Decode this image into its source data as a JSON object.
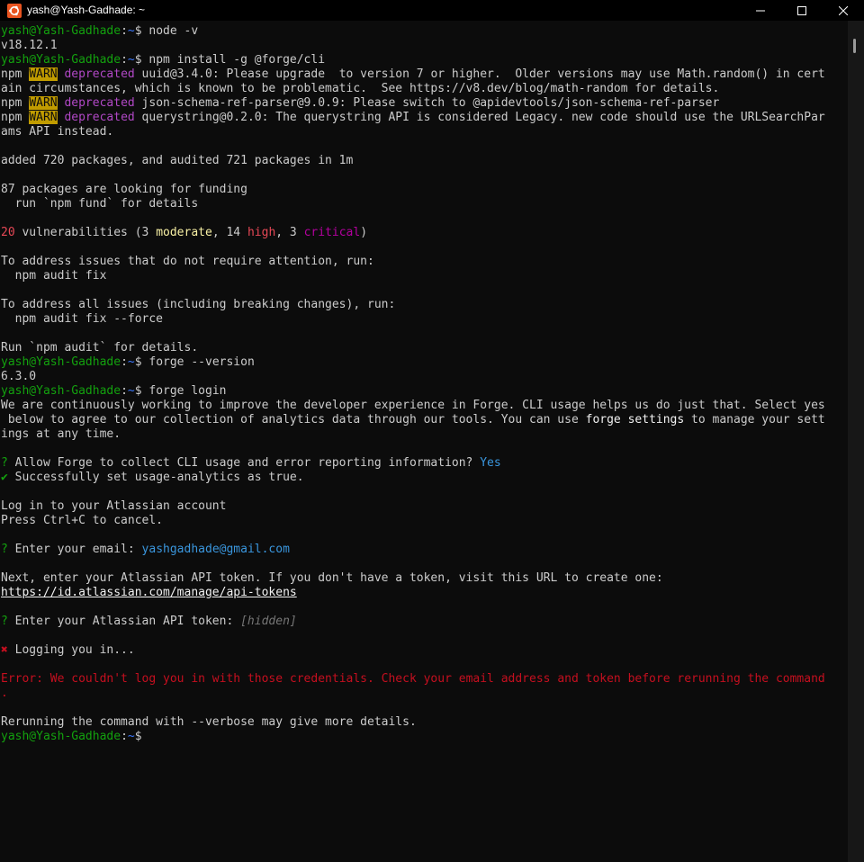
{
  "window": {
    "title": "yash@Yash-Gadhade: ~",
    "app_icon": "ubuntu-icon",
    "controls": [
      "minimize-icon",
      "maximize-icon",
      "close-icon"
    ]
  },
  "colors": {
    "prompt_user": "#13a10e",
    "prompt_path": "#3b78ff",
    "warn_badge": "#c19c00",
    "deprecated": "#b148c6",
    "error": "#c50f1f",
    "answer": "#3a96dd"
  },
  "prompts": [
    {
      "user": "yash@Yash-Gadhade",
      "sep": ":",
      "path": "~",
      "sym": "$ ",
      "cmd": "node -v"
    },
    {
      "user": "yash@Yash-Gadhade",
      "sep": ":",
      "path": "~",
      "sym": "$ ",
      "cmd": "npm install -g @forge/cli"
    },
    {
      "user": "yash@Yash-Gadhade",
      "sep": ":",
      "path": "~",
      "sym": "$ ",
      "cmd": "forge --version"
    },
    {
      "user": "yash@Yash-Gadhade",
      "sep": ":",
      "path": "~",
      "sym": "$ ",
      "cmd": "forge login"
    },
    {
      "user": "yash@Yash-Gadhade",
      "sep": ":",
      "path": "~",
      "sym": "$",
      "cmd": ""
    }
  ],
  "node_version": "v18.12.1",
  "warnings": [
    {
      "npm": "npm ",
      "badge": "WARN",
      "tag": " deprecated ",
      "msg": "uuid@3.4.0: Please upgrade  to version 7 or higher.  Older versions may use Math.random() in cert",
      "cont": "ain circumstances, which is known to be problematic.  See https://v8.dev/blog/math-random for details."
    },
    {
      "npm": "npm ",
      "badge": "WARN",
      "tag": " deprecated ",
      "msg": "json-schema-ref-parser@9.0.9: Please switch to @apidevtools/json-schema-ref-parser"
    },
    {
      "npm": "npm ",
      "badge": "WARN",
      "tag": " deprecated ",
      "msg": "querystring@0.2.0: The querystring API is considered Legacy. new code should use the URLSearchPar",
      "cont": "ams API instead."
    }
  ],
  "install": {
    "added": "added 720 packages, and audited 721 packages in 1m",
    "funding": "87 packages are looking for funding",
    "fund_hint": "  run `npm fund` for details"
  },
  "vulns": {
    "count": "20",
    "text_a": " vulnerabilities (3 ",
    "moderate": "moderate",
    "text_b": ", 14 ",
    "high": "high",
    "text_c": ", 3 ",
    "critical": "critical",
    "text_d": ")"
  },
  "audit": {
    "no_attention": "To address issues that do not require attention, run:",
    "fix_cmd": "  npm audit fix",
    "all_issues": "To address all issues (including breaking changes), run:",
    "force_cmd": "  npm audit fix --force",
    "details": "Run `npm audit` for details."
  },
  "forge_version": "6.3.0",
  "login": {
    "intro_1": "We are continuously working to improve the developer experience in Forge. CLI usage helps us do just that. Select yes",
    "intro_2a": " below to agree to our collection of analytics data through our tools. You can use ",
    "intro_2b": "forge settings",
    "intro_2c": " to manage your sett",
    "intro_3": "ings at any time.",
    "q_mark": "?",
    "q_analytics": " Allow Forge to collect CLI usage and error reporting information? ",
    "a_analytics": "Yes",
    "success_mark": "✔",
    "success": " Successfully set usage-analytics as true.",
    "account": "Log in to your Atlassian account",
    "cancel": "Press Ctrl+C to cancel.",
    "q_email": " Enter your email: ",
    "email": "yashgadhade@gmail.com",
    "token_info": "Next, enter your Atlassian API token. If you don't have a token, visit this URL to create one:",
    "token_url": "https://id.atlassian.com/manage/api-tokens",
    "q_token": " Enter your Atlassian API token: ",
    "token_hidden": "[hidden]",
    "fail_mark": "✖",
    "logging_in": " Logging you in...",
    "error_label": "Error:",
    "error_msg": " We couldn't log you in with those credentials. Check your email address and token before rerunning the command",
    "error_cont": ".",
    "verbose": "Rerunning the command with --verbose may give more details."
  }
}
